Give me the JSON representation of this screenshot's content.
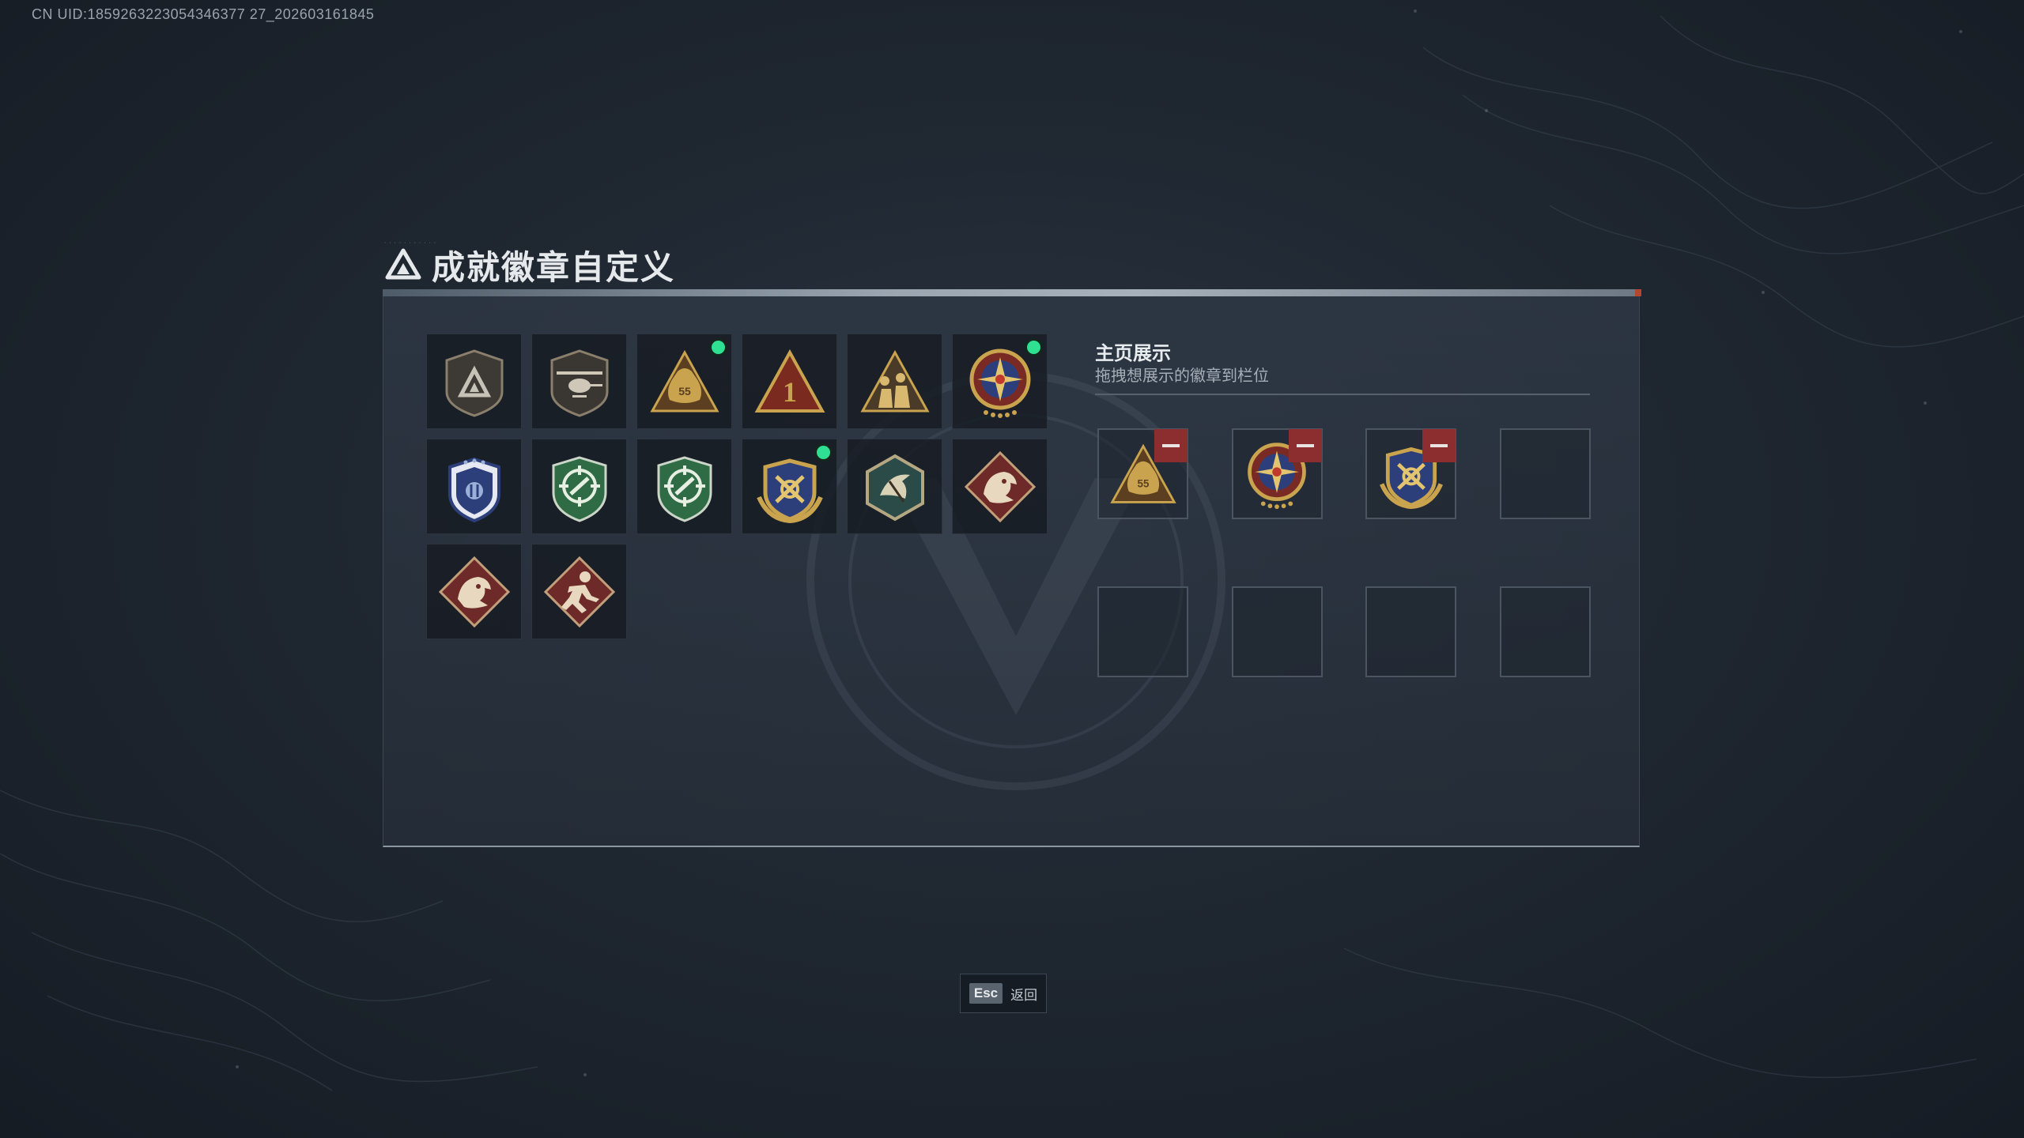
{
  "uid_text": "CN UID:1859263223054346377 27_202603161845",
  "dialog": {
    "title": "成就徽章自定义",
    "title_tiny": "· · · · · · · · · · ·"
  },
  "badges": [
    {
      "name": "badge-triangle-shield",
      "icon": "triangle-shield",
      "new": false
    },
    {
      "name": "badge-helicopter-shield",
      "icon": "helicopter-shield",
      "new": false
    },
    {
      "name": "badge-55-bag",
      "icon": "money-bag-55",
      "new": true,
      "text": "55"
    },
    {
      "name": "badge-number-1",
      "icon": "number-one-triangle",
      "new": false,
      "text": "1"
    },
    {
      "name": "badge-soldiers",
      "icon": "soldiers-triangle",
      "new": false
    },
    {
      "name": "badge-star-compass",
      "icon": "star-compass-medal",
      "new": true
    },
    {
      "name": "badge-police-shield",
      "icon": "police-shield",
      "new": false
    },
    {
      "name": "badge-crosshair-green-1",
      "icon": "crosshair-green-shield",
      "new": false
    },
    {
      "name": "badge-crosshair-green-2",
      "icon": "crosshair-green-shield",
      "new": false
    },
    {
      "name": "badge-eagle-anchor",
      "icon": "eagle-anchor-crest",
      "new": true
    },
    {
      "name": "badge-hexagon-bird",
      "icon": "hexagon-bird",
      "new": false
    },
    {
      "name": "badge-dragon-1",
      "icon": "dragon-diamond",
      "new": false
    },
    {
      "name": "badge-dragon-2",
      "icon": "dragon-diamond",
      "new": false
    },
    {
      "name": "badge-runner",
      "icon": "runner-diamond",
      "new": false
    }
  ],
  "showcase": {
    "title": "主页展示",
    "subtitle": "拖拽想展示的徽章到栏位",
    "slots": [
      {
        "icon": "money-bag-55",
        "filled": true,
        "text": "55"
      },
      {
        "icon": "star-compass-medal",
        "filled": true
      },
      {
        "icon": "eagle-anchor-crest",
        "filled": true
      },
      {
        "filled": false
      },
      {
        "filled": false
      },
      {
        "filled": false
      },
      {
        "filled": false
      },
      {
        "filled": false
      }
    ]
  },
  "footer": {
    "key": "Esc",
    "label": "返回"
  },
  "colors": {
    "new_dot": "#2fe093",
    "remove_button": "#8c2d30",
    "gold": "#c9a34e",
    "navy": "#2d3f7a",
    "green": "#2f6b45",
    "dragon_red": "#6e2a28"
  }
}
